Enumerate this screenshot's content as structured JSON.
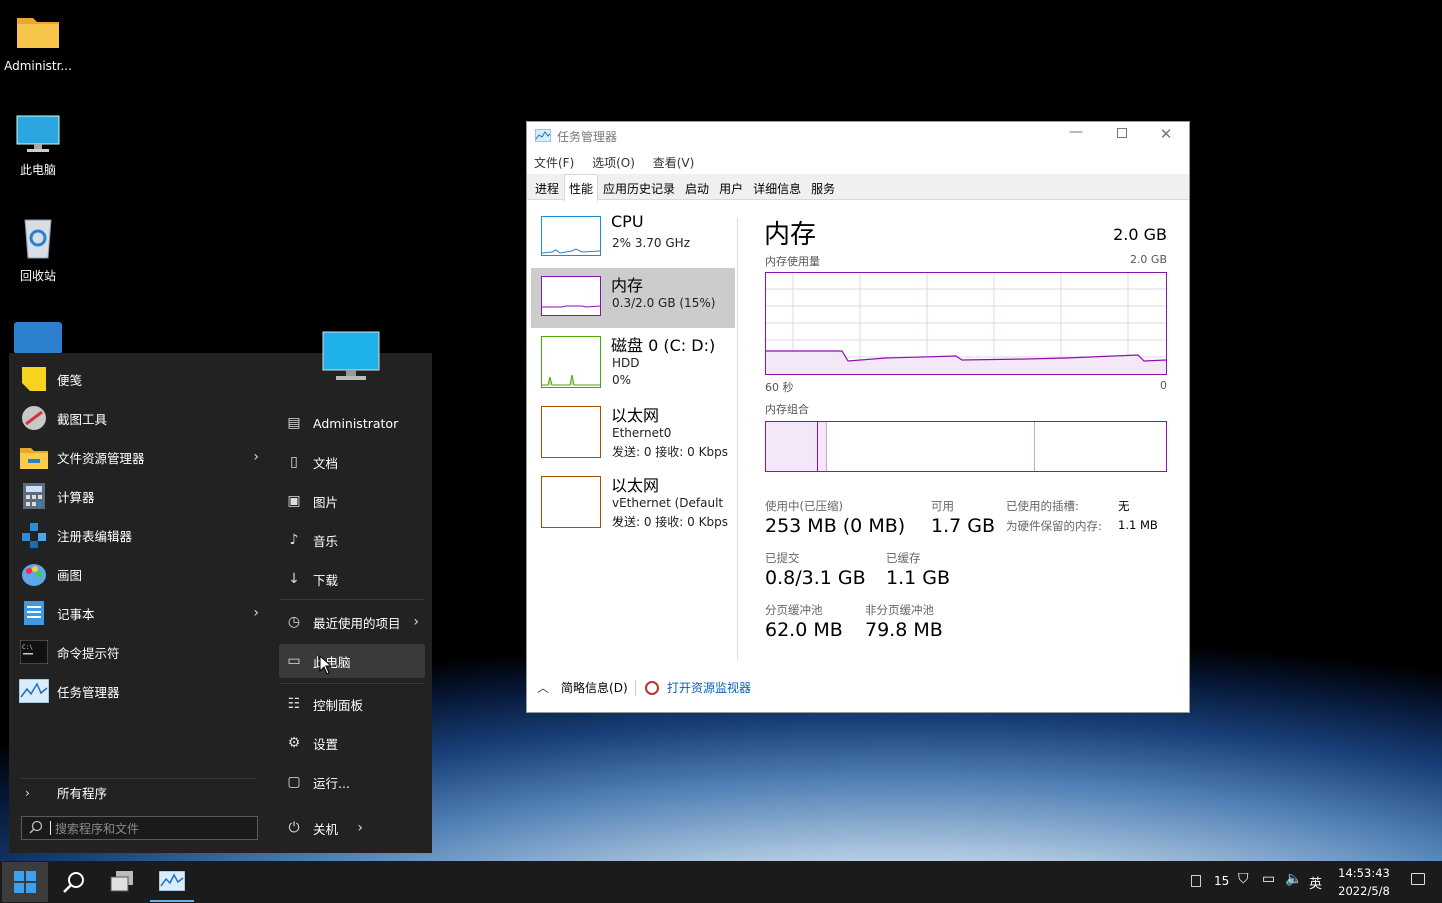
{
  "desktop": {
    "icons": [
      {
        "label": "Administr...",
        "icon": "folder-icon"
      },
      {
        "label": "此电脑",
        "icon": "monitor-icon"
      },
      {
        "label": "回收站",
        "icon": "recycle-bin-icon"
      }
    ]
  },
  "start_menu": {
    "apps": [
      {
        "label": "便笺",
        "icon": "sticky-notes-icon",
        "has_arrow": false
      },
      {
        "label": "截图工具",
        "icon": "snipping-tool-icon",
        "has_arrow": false
      },
      {
        "label": "文件资源管理器",
        "icon": "file-explorer-icon",
        "has_arrow": true
      },
      {
        "label": "计算器",
        "icon": "calculator-icon",
        "has_arrow": false
      },
      {
        "label": "注册表编辑器",
        "icon": "registry-editor-icon",
        "has_arrow": false
      },
      {
        "label": "画图",
        "icon": "paint-icon",
        "has_arrow": false
      },
      {
        "label": "记事本",
        "icon": "notepad-icon",
        "has_arrow": true
      },
      {
        "label": "命令提示符",
        "icon": "cmd-icon",
        "has_arrow": false
      },
      {
        "label": "任务管理器",
        "icon": "task-manager-icon",
        "has_arrow": false
      }
    ],
    "all_programs": "所有程序",
    "search_placeholder": "搜索程序和文件",
    "places": [
      {
        "label": "Administrator",
        "icon": "user-folder-icon"
      },
      {
        "label": "文档",
        "icon": "document-icon"
      },
      {
        "label": "图片",
        "icon": "picture-icon"
      },
      {
        "label": "音乐",
        "icon": "music-icon"
      },
      {
        "label": "下载",
        "icon": "download-icon"
      },
      {
        "label": "最近使用的项目",
        "icon": "recent-icon"
      },
      {
        "label": "此电脑",
        "icon": "computer-icon"
      },
      {
        "label": "控制面板",
        "icon": "control-panel-icon"
      },
      {
        "label": "设置",
        "icon": "settings-icon"
      },
      {
        "label": "运行...",
        "icon": "run-icon"
      }
    ],
    "shutdown": "关机"
  },
  "task_manager": {
    "title": "任务管理器",
    "menu": [
      "文件(F)",
      "选项(O)",
      "查看(V)"
    ],
    "tabs": [
      "进程",
      "性能",
      "应用历史记录",
      "启动",
      "用户",
      "详细信息",
      "服务"
    ],
    "active_tab": "性能",
    "sidebar": [
      {
        "name": "CPU",
        "line1": "2% 3.70 GHz",
        "line2": "",
        "color": "#1e8bd3"
      },
      {
        "name": "内存",
        "line1": "0.3/2.0 GB (15%)",
        "line2": "",
        "color": "#8b12ae"
      },
      {
        "name": "磁盘 0 (C: D:)",
        "line1": "HDD",
        "line2": "0%",
        "color": "#4da60c"
      },
      {
        "name": "以太网",
        "line1": "Ethernet0",
        "line2": "发送: 0 接收: 0 Kbps",
        "color": "#a74f01"
      },
      {
        "name": "以太网",
        "line1": "vEthernet (Default ...",
        "line2": "发送: 0 接收: 0 Kbps",
        "color": "#a74f01"
      }
    ],
    "main": {
      "heading": "内存",
      "total": "2.0 GB",
      "usage_label": "内存使用量",
      "usage_max": "2.0 GB",
      "axis_left": "60 秒",
      "axis_right": "0",
      "composition_label": "内存组合",
      "stats": {
        "in_use_label": "使用中(已压缩)",
        "in_use": "253 MB (0 MB)",
        "available_label": "可用",
        "available": "1.7 GB",
        "slots_label": "已使用的插槽:",
        "slots": "无",
        "reserved_label": "为硬件保留的内存:",
        "reserved": "1.1 MB",
        "committed_label": "已提交",
        "committed": "0.8/3.1 GB",
        "cached_label": "已缓存",
        "cached": "1.1 GB",
        "paged_label": "分页缓冲池",
        "paged": "62.0 MB",
        "nonpaged_label": "非分页缓冲池",
        "nonpaged": "79.8 MB"
      }
    },
    "footer": {
      "fewer": "简略信息(D)",
      "monitor": "打开资源监视器"
    }
  },
  "taskbar": {
    "tray_num": "15",
    "ime": "英",
    "time": "14:53:43",
    "date": "2022/5/8"
  }
}
